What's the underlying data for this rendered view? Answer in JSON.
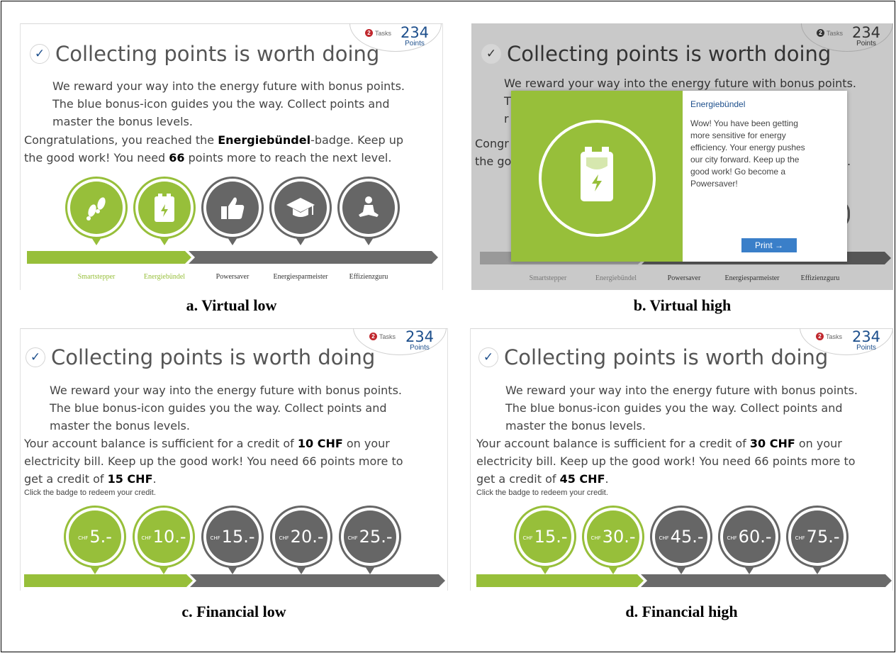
{
  "shared": {
    "tasks_count": "2",
    "tasks_label": "Tasks",
    "points_value": "234",
    "points_label": "Points",
    "title": "Collecting points is worth doing",
    "intro_lines": [
      "We reward your way into the energy future with bonus points.",
      "The blue bonus-icon guides you the way. Collect points and",
      "master the bonus levels."
    ],
    "levels": [
      "Smartstepper",
      "Energiebündel",
      "Powersaver",
      "Energiesparmeister",
      "Effizienzguru"
    ],
    "colors": {
      "green": "#97bf3a",
      "dark": "#666666",
      "blue": "#1d4f8c",
      "button": "#3a7fc9",
      "badge_red": "#c0272d"
    }
  },
  "panel_a": {
    "caption": "a. Virtual low",
    "msg_line1_pre": "Congratulations, you reached the ",
    "msg_badge": "Energiebündel",
    "msg_line1_post": "-badge. Keep up",
    "msg_line2_pre": "the good work! You need ",
    "msg_points": "66",
    "msg_line2_post": " points more to reach the next level.",
    "badge_icons": [
      "footsteps-icon",
      "battery-icon",
      "thumbs-up-icon",
      "graduation-cap-icon",
      "meditation-icon"
    ]
  },
  "panel_b": {
    "caption": "b. Virtual high",
    "frag_t": "T",
    "frag_r": "r",
    "frag_congr": "Congr",
    "frag_thego": "the go",
    "frag_dot": ".",
    "modal_title": "Energiebündel",
    "modal_text": "Wow! You have been getting more sensitive for energy efficiency. Your energy pushes our city forward. Keep up the good work! Go become a Powersaver!",
    "print_label": "Print →"
  },
  "panel_c": {
    "caption": "c. Financial low",
    "msg_line1_pre": "Your account balance is sufficient for a credit of ",
    "credit_now": "10 CHF",
    "msg_line1_post": " on your",
    "msg_line2": "electricity bill. Keep up the good work! You need 66 points more to",
    "msg_line3_pre": "get a credit of ",
    "credit_next": "15 CHF",
    "msg_line3_post": ".",
    "hint": "Click the badge to redeem your credit.",
    "currency": "CHF",
    "amounts": [
      "5.-",
      "10.-",
      "15.-",
      "20.-",
      "25.-"
    ]
  },
  "panel_d": {
    "caption": "d. Financial high",
    "msg_line1_pre": "Your account balance is sufficient for a credit of ",
    "credit_now": "30 CHF",
    "msg_line1_post": " on your",
    "msg_line2": "electricity bill. Keep up the good work! You need 66 points more to",
    "msg_line3_pre": "get a credit of ",
    "credit_next": "45 CHF",
    "msg_line3_post": ".",
    "hint": "Click the badge to redeem your credit.",
    "currency": "CHF",
    "amounts": [
      "15.-",
      "30.-",
      "45.-",
      "60.-",
      "75.-"
    ]
  }
}
